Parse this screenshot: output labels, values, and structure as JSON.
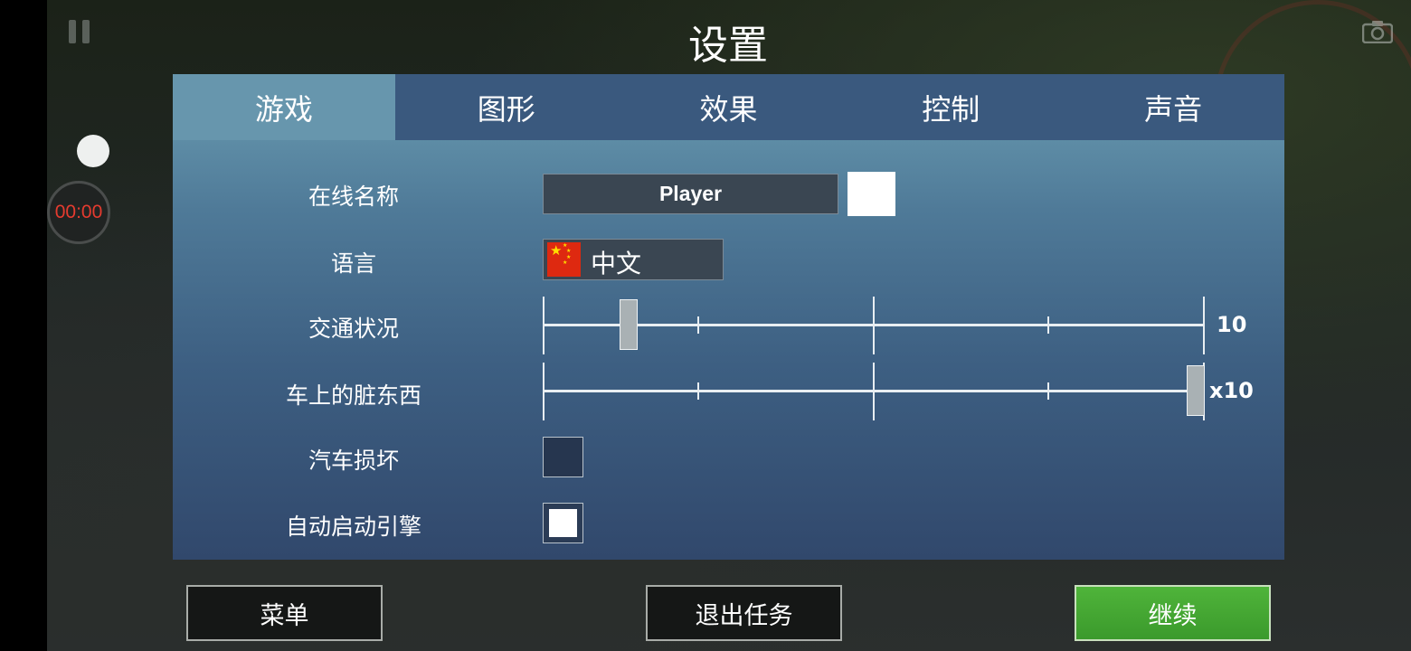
{
  "title": "设置",
  "tabs": [
    {
      "label": "游戏",
      "active": true
    },
    {
      "label": "图形",
      "active": false
    },
    {
      "label": "效果",
      "active": false
    },
    {
      "label": "控制",
      "active": false
    },
    {
      "label": "声音",
      "active": false
    }
  ],
  "recorder": {
    "timer": "00:00"
  },
  "settings": {
    "online_name": {
      "label": "在线名称",
      "value": "Player",
      "color": "#ffffff"
    },
    "language": {
      "label": "语言",
      "value": "中文",
      "flag_icon": "china-flag-icon"
    },
    "traffic": {
      "label": "交通状况",
      "value": "10",
      "level": 0.12
    },
    "car_dirt": {
      "label": "车上的脏东西",
      "value": "x10",
      "level": 1.0
    },
    "car_damage": {
      "label": "汽车损坏",
      "checked": false
    },
    "auto_start_engine": {
      "label": "自动启动引擎",
      "checked": true
    }
  },
  "buttons": {
    "menu": "菜单",
    "exit_mission": "退出任务",
    "continue": "继续"
  },
  "colors": {
    "accent_green": "#45a834",
    "tab_active": "#6796ad",
    "tab_bar": "#3a597e",
    "timer_red": "#e53b2f"
  }
}
